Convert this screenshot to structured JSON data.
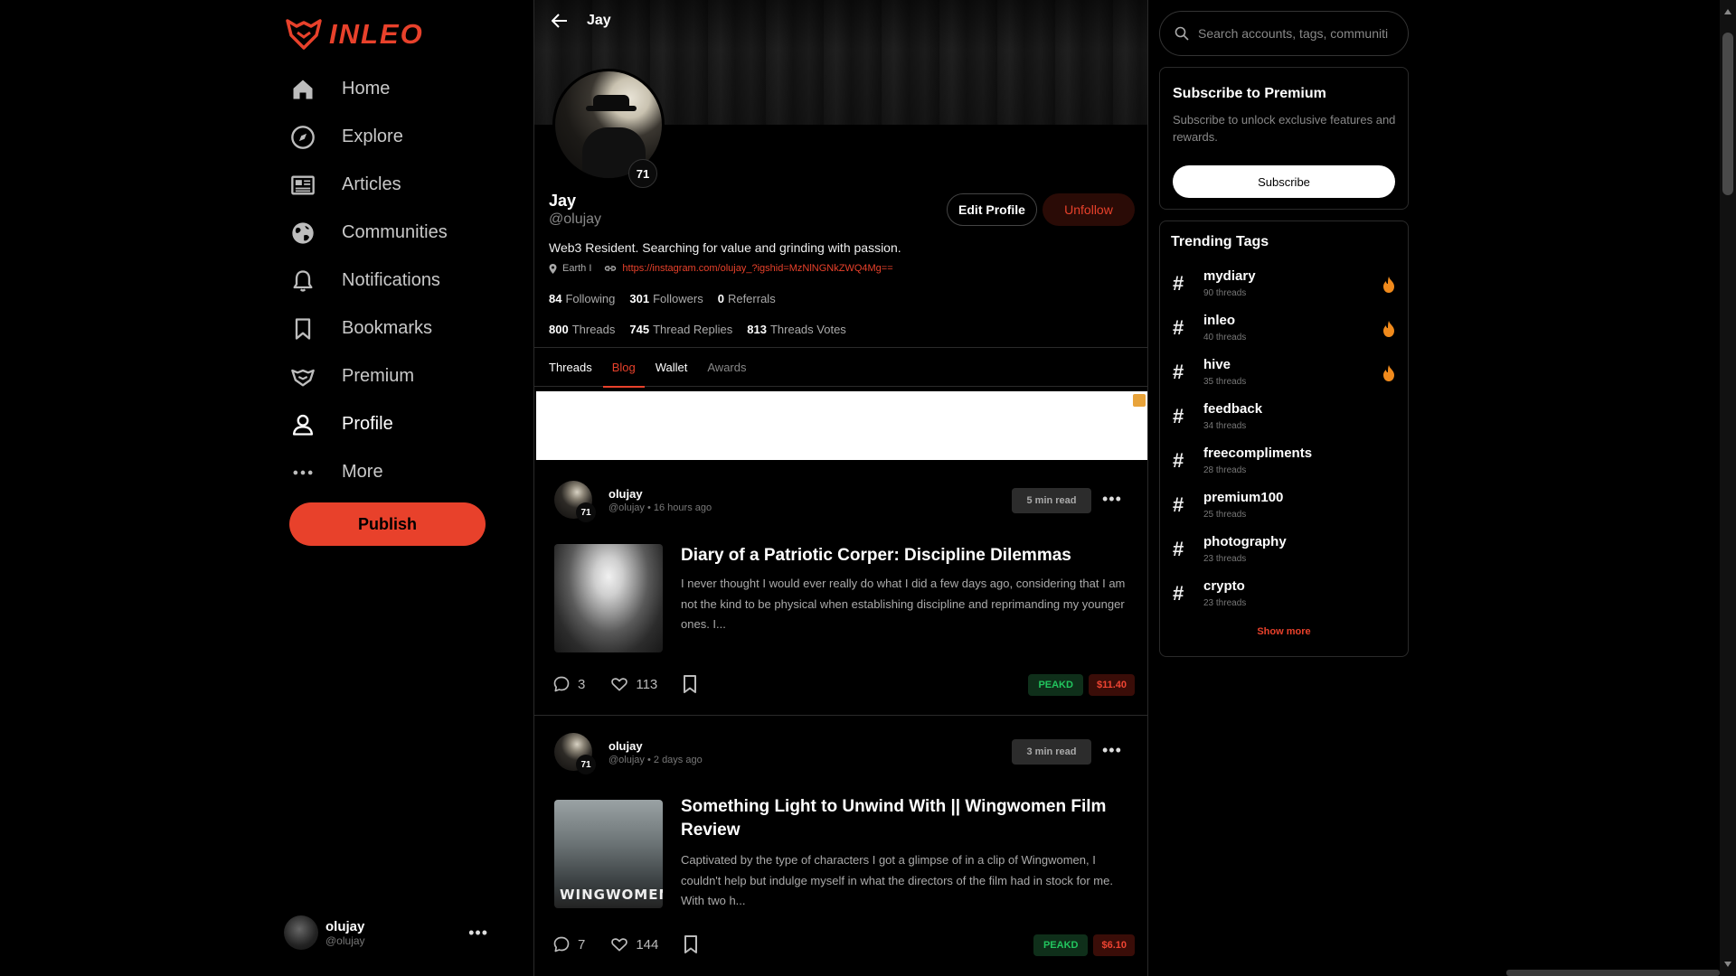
{
  "brand": {
    "name": "INLEO",
    "accent": "#e8412b"
  },
  "nav": [
    {
      "label": "Home",
      "icon": "home-icon",
      "active": false
    },
    {
      "label": "Explore",
      "icon": "compass-icon",
      "active": false
    },
    {
      "label": "Articles",
      "icon": "newspaper-icon",
      "active": false
    },
    {
      "label": "Communities",
      "icon": "globe-icon",
      "active": false
    },
    {
      "label": "Notifications",
      "icon": "bell-icon",
      "active": false
    },
    {
      "label": "Bookmarks",
      "icon": "bookmark-icon",
      "active": false
    },
    {
      "label": "Premium",
      "icon": "premium-icon",
      "active": false
    },
    {
      "label": "Profile",
      "icon": "user-icon",
      "active": true
    },
    {
      "label": "More",
      "icon": "more-dots-icon",
      "active": false
    }
  ],
  "publish_label": "Publish",
  "account": {
    "name": "olujay",
    "handle": "@olujay"
  },
  "profile": {
    "header_title": "Jay",
    "level": "71",
    "name": "Jay",
    "handle": "@olujay",
    "edit_label": "Edit Profile",
    "unfollow_label": "Unfollow",
    "bio": "Web3 Resident. Searching for value and grinding with passion.",
    "location": "Earth I",
    "link": "https://instagram.com/olujay_?igshid=MzNlNGNkZWQ4Mg==",
    "stats": {
      "following": "84",
      "following_label": "Following",
      "followers": "301",
      "followers_label": "Followers",
      "referrals": "0",
      "referrals_label": "Referrals",
      "threads": "800",
      "threads_label": "Threads",
      "replies": "745",
      "replies_label": "Thread Replies",
      "votes": "813",
      "votes_label": "Threads Votes"
    }
  },
  "tabs": [
    {
      "label": "Threads",
      "state": "normal"
    },
    {
      "label": "Blog",
      "state": "active"
    },
    {
      "label": "Wallet",
      "state": "normal"
    },
    {
      "label": "Awards",
      "state": "dim"
    }
  ],
  "posts": [
    {
      "author": "olujay",
      "level": "71",
      "handle": "@olujay",
      "time": "16 hours ago",
      "read": "5 min read",
      "title": "Diary of a Patriotic Corper: Discipline Dilemmas",
      "excerpt": "I never thought I would ever really do what I did a few days ago, considering that I am not the kind to be physical when establishing discipline and reprimanding my younger ones. I...",
      "comments": "3",
      "likes": "113",
      "source": "PEAKD",
      "payout": "$11.40"
    },
    {
      "author": "olujay",
      "level": "71",
      "handle": "@olujay",
      "time": "2 days ago",
      "read": "3 min read",
      "title": "Something Light to Unwind With || Wingwomen Film Review",
      "excerpt": "Captivated by the type of characters I got a glimpse of in a clip of Wingwomen, I couldn't help but indulge myself in what the directors of the film had in stock for me. With two h...",
      "comments": "7",
      "likes": "144",
      "source": "PEAKD",
      "payout": "$6.10",
      "thumb_text": "WINGWOMEN"
    }
  ],
  "search": {
    "placeholder": "Search accounts, tags, communities"
  },
  "premium_card": {
    "title": "Subscribe to Premium",
    "desc": "Subscribe to unlock exclusive features and rewards.",
    "button": "Subscribe"
  },
  "trending": {
    "title": "Trending Tags",
    "tags": [
      {
        "name": "mydiary",
        "count": "90 threads",
        "hot": true
      },
      {
        "name": "inleo",
        "count": "40 threads",
        "hot": true
      },
      {
        "name": "hive",
        "count": "35 threads",
        "hot": true
      },
      {
        "name": "feedback",
        "count": "34 threads",
        "hot": false
      },
      {
        "name": "freecompliments",
        "count": "28 threads",
        "hot": false
      },
      {
        "name": "premium100",
        "count": "25 threads",
        "hot": false
      },
      {
        "name": "photography",
        "count": "23 threads",
        "hot": false
      },
      {
        "name": "crypto",
        "count": "23 threads",
        "hot": false
      }
    ],
    "show_more": "Show more"
  }
}
